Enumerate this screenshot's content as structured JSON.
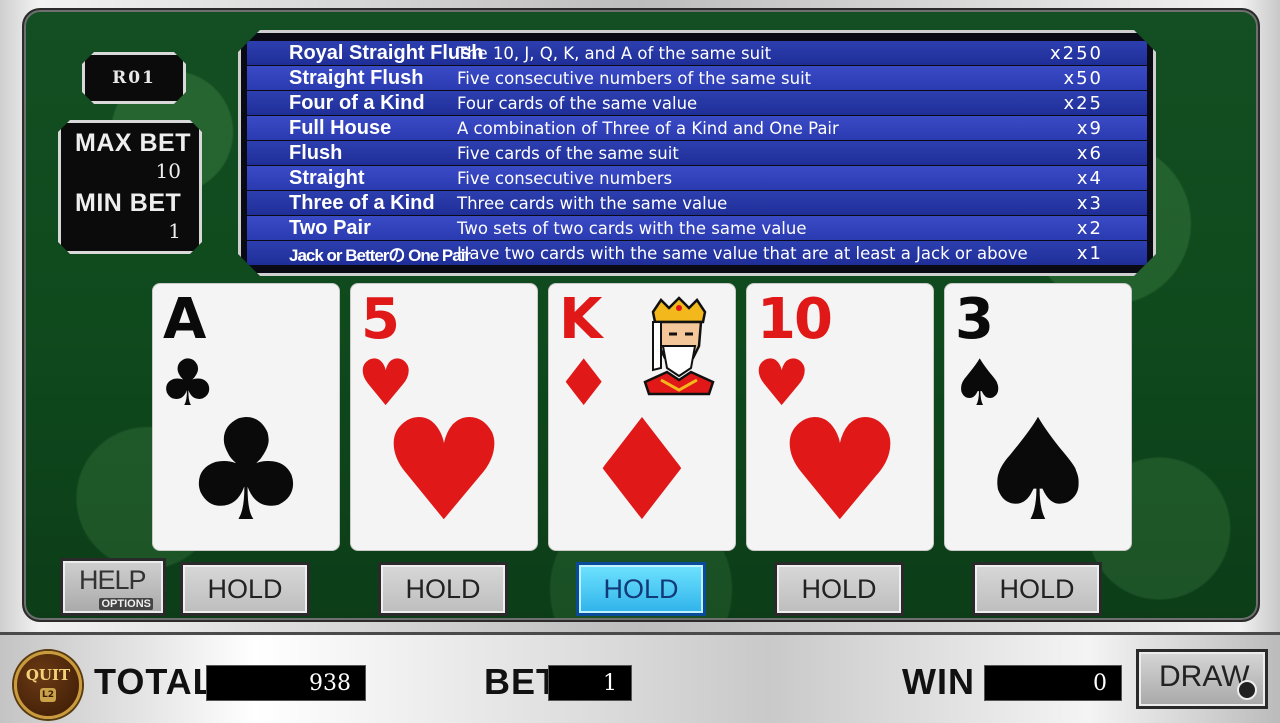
{
  "round": "R01",
  "bet_limits": {
    "max_label": "MAX BET",
    "max_value": "10",
    "min_label": "MIN BET",
    "min_value": "1"
  },
  "paytable": [
    {
      "hand": "Royal Straight Flush",
      "desc": "The 10, J, Q, K, and A of the same suit",
      "mult": "x250"
    },
    {
      "hand": "Straight Flush",
      "desc": "Five consecutive numbers of the same suit",
      "mult": "x50"
    },
    {
      "hand": "Four of a Kind",
      "desc": "Four cards of the same value",
      "mult": "x25"
    },
    {
      "hand": "Full House",
      "desc": "A combination of Three of a Kind and One Pair",
      "mult": "x9"
    },
    {
      "hand": "Flush",
      "desc": "Five cards of the same suit",
      "mult": "x6"
    },
    {
      "hand": "Straight",
      "desc": "Five consecutive numbers",
      "mult": "x4"
    },
    {
      "hand": "Three of a Kind",
      "desc": "Three cards with the same value",
      "mult": "x3"
    },
    {
      "hand": "Two Pair",
      "desc": "Two sets of two cards with the same value",
      "mult": "x2"
    },
    {
      "hand": "Jack or Betterの One Pair",
      "desc": "Have two cards with the same value that are at least a Jack or above",
      "mult": "x1"
    }
  ],
  "cards": [
    {
      "rank": "A",
      "suit": "♣",
      "suit_name": "club-icon",
      "color": "#0a0a0a"
    },
    {
      "rank": "5",
      "suit": "♥",
      "suit_name": "heart-icon",
      "color": "#e01818"
    },
    {
      "rank": "K",
      "suit": "♦",
      "suit_name": "diamond-icon",
      "color": "#e01818",
      "face": "king-icon"
    },
    {
      "rank": "10",
      "suit": "♥",
      "suit_name": "heart-icon",
      "color": "#e01818"
    },
    {
      "rank": "3",
      "suit": "♠",
      "suit_name": "spade-icon",
      "color": "#0a0a0a"
    }
  ],
  "hold_buttons": [
    {
      "label": "HOLD",
      "active": false
    },
    {
      "label": "HOLD",
      "active": false
    },
    {
      "label": "HOLD",
      "active": true
    },
    {
      "label": "HOLD",
      "active": false
    },
    {
      "label": "HOLD",
      "active": false
    }
  ],
  "help": {
    "label": "HELP",
    "sub": "OPTIONS"
  },
  "quit": {
    "label": "QUIT",
    "key": "L2"
  },
  "total": {
    "label": "TOTAL",
    "value": "938"
  },
  "bet": {
    "label": "BET",
    "value": "1"
  },
  "win": {
    "label": "WIN",
    "value": "0"
  },
  "draw": {
    "label": "DRAW"
  },
  "colors": {
    "felt": "#134f22",
    "paytable_row": "#2d3fb0",
    "hold_active": "#2fb2ea",
    "red_suit": "#e01818"
  }
}
